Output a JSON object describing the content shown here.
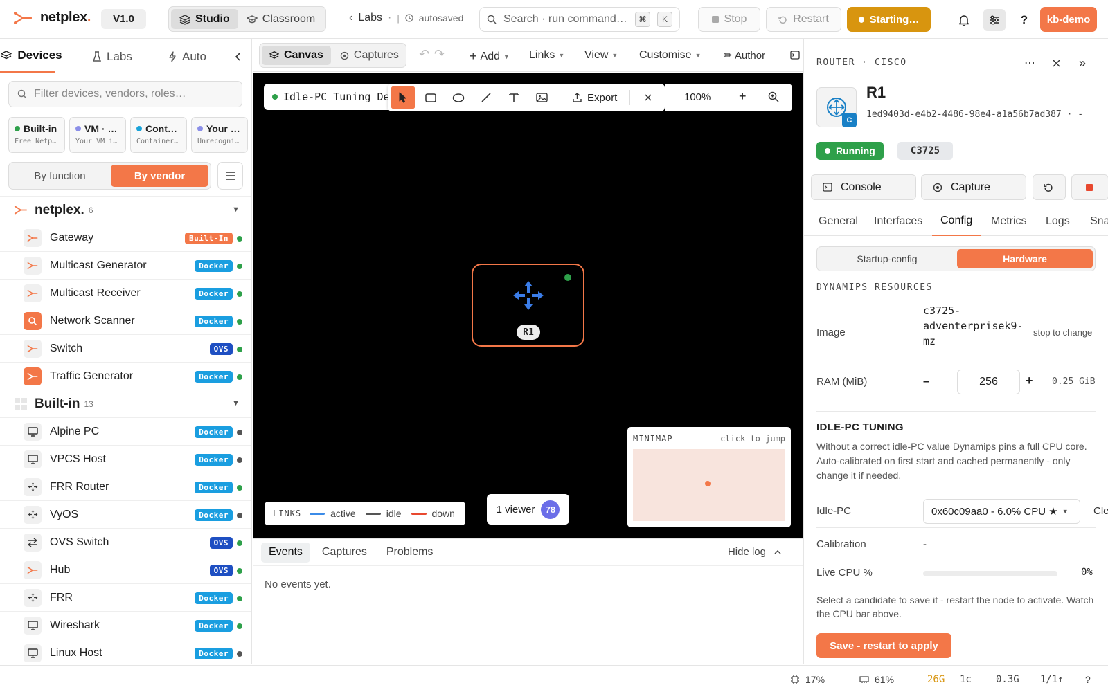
{
  "app": {
    "name": "netplex",
    "name_dot": ".",
    "version": "V1.0",
    "modes": [
      "Studio",
      "Classroom"
    ],
    "breadcrumb": "Labs",
    "save_state": "autosaved",
    "search_placeholder": "Search · run command…",
    "search_keys": [
      "⌘",
      "K"
    ],
    "stop_label": "Stop",
    "restart_label": "Restart",
    "starting_label": "Starting…",
    "user": "kb-demo",
    "help_label": "?"
  },
  "sidebar": {
    "tabs": [
      "Devices",
      "Labs",
      "Auto"
    ],
    "filter_placeholder": "Filter devices, vendors, roles…",
    "categories": [
      {
        "title": "Built-in",
        "sub": "Free Netplex",
        "color": "#2ea04a"
      },
      {
        "title": "VM · Images",
        "sub": "Your VM images",
        "color": "#8b8fe8"
      },
      {
        "title": "Containers",
        "sub": "Container images",
        "color": "#1aa3d9"
      },
      {
        "title": "Your Images",
        "sub": "Unrecognized",
        "color": "#8b8fe8"
      }
    ],
    "group_by": [
      "By function",
      "By vendor"
    ],
    "groups": [
      {
        "name": "netplex.",
        "count": "6",
        "items": [
          {
            "name": "Gateway",
            "badge": "Built-In",
            "badge_color": "#f37748",
            "status_color": "#2ea04a",
            "icon": "netplex-icon"
          },
          {
            "name": "Multicast Generator",
            "badge": "Docker",
            "badge_color": "#1a9ee0",
            "status_color": "#2ea04a",
            "icon": "netplex-icon"
          },
          {
            "name": "Multicast Receiver",
            "badge": "Docker",
            "badge_color": "#1a9ee0",
            "status_color": "#2ea04a",
            "icon": "netplex-icon"
          },
          {
            "name": "Network Scanner",
            "badge": "Docker",
            "badge_color": "#1a9ee0",
            "status_color": "#2ea04a",
            "icon": "scanner-icon"
          },
          {
            "name": "Switch",
            "badge": "OVS",
            "badge_color": "#1e4fc2",
            "status_color": "#2ea04a",
            "icon": "netplex-icon"
          },
          {
            "name": "Traffic Generator",
            "badge": "Docker",
            "badge_color": "#1a9ee0",
            "status_color": "#2ea04a",
            "icon": "traffic-icon"
          }
        ]
      },
      {
        "name": "Built-in",
        "count": "13",
        "items": [
          {
            "name": "Alpine PC",
            "badge": "Docker",
            "badge_color": "#1a9ee0",
            "status_color": "#555555",
            "icon": "monitor-icon"
          },
          {
            "name": "VPCS Host",
            "badge": "Docker",
            "badge_color": "#1a9ee0",
            "status_color": "#555555",
            "icon": "monitor-icon"
          },
          {
            "name": "FRR Router",
            "badge": "Docker",
            "badge_color": "#1a9ee0",
            "status_color": "#2ea04a",
            "icon": "router-icon"
          },
          {
            "name": "VyOS",
            "badge": "Docker",
            "badge_color": "#1a9ee0",
            "status_color": "#555555",
            "icon": "router-icon"
          },
          {
            "name": "OVS Switch",
            "badge": "OVS",
            "badge_color": "#1e4fc2",
            "status_color": "#2ea04a",
            "icon": "switch-icon"
          },
          {
            "name": "Hub",
            "badge": "OVS",
            "badge_color": "#1e4fc2",
            "status_color": "#2ea04a",
            "icon": "netplex-icon"
          },
          {
            "name": "FRR",
            "badge": "Docker",
            "badge_color": "#1a9ee0",
            "status_color": "#2ea04a",
            "icon": "router-icon"
          },
          {
            "name": "Wireshark",
            "badge": "Docker",
            "badge_color": "#1a9ee0",
            "status_color": "#2ea04a",
            "icon": "monitor-icon"
          },
          {
            "name": "Linux Host",
            "badge": "Docker",
            "badge_color": "#1a9ee0",
            "status_color": "#555555",
            "icon": "monitor-icon"
          }
        ]
      }
    ]
  },
  "canvas_toolbar": {
    "views": [
      "Canvas",
      "Captures"
    ],
    "menus": [
      "Add",
      "Links",
      "View",
      "Customise"
    ],
    "author_label": "✏ Author"
  },
  "canvas": {
    "lab_title": "Idle-PC Tuning Demo",
    "export_label": "Export",
    "zoom": "100%",
    "zoom_plus": "+",
    "node_label": "R1",
    "legend": {
      "title": "LINKS",
      "items": [
        {
          "label": "active",
          "color": "#3b8be8"
        },
        {
          "label": "idle",
          "color": "#555555"
        },
        {
          "label": "down",
          "color": "#e8482f"
        }
      ]
    },
    "viewers_label": "1 viewer",
    "viewers_count": "78",
    "minimap_title": "MINIMAP",
    "minimap_hint": "click to jump"
  },
  "log": {
    "tabs": [
      "Events",
      "Captures",
      "Problems"
    ],
    "hide_label": "Hide log",
    "empty": "No events yet."
  },
  "details": {
    "header": "ROUTER · CISCO",
    "name": "R1",
    "uuid": "1ed9403d-e4b2-4486-98e4-a1a56b7ad387 · -",
    "avatar_badge": "C",
    "status": "Running",
    "model": "C3725",
    "console_label": "Console",
    "capture_label": "Capture",
    "tabs": [
      "General",
      "Interfaces",
      "Config",
      "Metrics",
      "Logs",
      "Snapshots"
    ],
    "config_views": [
      "Startup-config",
      "Hardware"
    ],
    "resources_heading": "DYNAMIPS RESOURCES",
    "image_label": "Image",
    "image_value": "c3725-adventerprisek9-mz",
    "image_hint": "stop to change",
    "ram_label": "RAM (MiB)",
    "ram_value": "256",
    "ram_minus": "–",
    "ram_plus": "+",
    "ram_gib": "0.25 GiB",
    "idle_heading": "IDLE-PC TUNING",
    "idle_desc": "Without a correct idle-PC value Dynamips pins a full CPU core. Auto-calibrated on first start and cached permanently - only change it if needed.",
    "idlepc_label": "Idle-PC",
    "idlepc_value": "0x60c09aa0 - 6.0% CPU ★",
    "clear_label": "Clear",
    "calibration_label": "Calibration",
    "calibration_value": "-",
    "livecpu_label": "Live CPU %",
    "livecpu_value": "0%",
    "livecpu_fraction": 0,
    "hint": "Select a candidate to save it - restart the node to activate. Watch the CPU bar above.",
    "save_label": "Save - restart to apply"
  },
  "statusbar": {
    "cpu": "17%",
    "mem": "61%",
    "disk": "26G",
    "cores": "1c",
    "load": "0.3G",
    "ratio": "1/1↑",
    "help": "?"
  },
  "colors": {
    "accent": "#f37748",
    "running": "#2ea04a",
    "starting": "#d8950f",
    "canvas_bg": "#000000"
  }
}
